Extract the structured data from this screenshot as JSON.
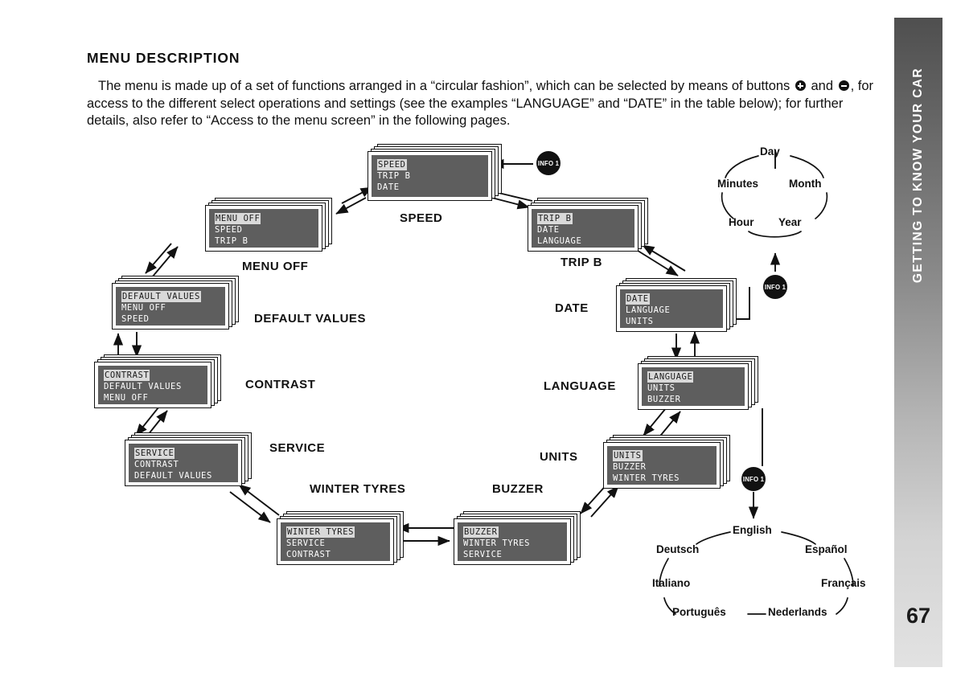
{
  "section": {
    "title": "MENU DESCRIPTION",
    "paragraph_part1": "The menu is made up of a set of functions arranged in a “circular fashion”, which can be selected by means of buttons",
    "paragraph_and": "and",
    "paragraph_part2": ", for access to the different select operations and settings (see the examples “LANGUAGE” and “DATE” in the table below); for further details, also refer to “Access to the menu screen” in the following pages."
  },
  "side_tab": {
    "chapter_label": "GETTING TO KNOW YOUR CAR",
    "page_number": "67",
    "gradient_top": "#4f4f4f",
    "gradient_bottom": "#e2e2e2"
  },
  "colors": {
    "lcd_background": "#5e5e5e",
    "lcd_text": "#ffffff",
    "lcd_highlight": "#d9d9d9",
    "ink": "#111111"
  },
  "info_badges": [
    {
      "id": "info-speed",
      "label": "INFO 1"
    },
    {
      "id": "info-date",
      "label": "INFO 1"
    },
    {
      "id": "info-language",
      "label": "INFO 1"
    }
  ],
  "panels": [
    {
      "id": "speed",
      "caption": "SPEED",
      "lines": [
        "SPEED",
        "TRIP B",
        "DATE"
      ],
      "selected": 0
    },
    {
      "id": "trip-b",
      "caption": "TRIP B",
      "lines": [
        "TRIP B",
        "DATE",
        "LANGUAGE"
      ],
      "selected": 0
    },
    {
      "id": "date",
      "caption": "DATE",
      "lines": [
        "DATE",
        "LANGUAGE",
        "UNITS"
      ],
      "selected": 0
    },
    {
      "id": "language",
      "caption": "LANGUAGE",
      "lines": [
        "LANGUAGE",
        "UNITS",
        "BUZZER"
      ],
      "selected": 0
    },
    {
      "id": "units",
      "caption": "UNITS",
      "lines": [
        "UNITS",
        "BUZZER",
        "WINTER TYRES"
      ],
      "selected": 0
    },
    {
      "id": "buzzer",
      "caption": "BUZZER",
      "lines": [
        "BUZZER",
        "WINTER TYRES",
        "SERVICE"
      ],
      "selected": 0
    },
    {
      "id": "winter-tyres",
      "caption": "WINTER TYRES",
      "lines": [
        "WINTER TYRES",
        "SERVICE",
        "CONTRAST"
      ],
      "selected": 0
    },
    {
      "id": "service",
      "caption": "SERVICE",
      "lines": [
        "SERVICE",
        "CONTRAST",
        "DEFAULT VALUES"
      ],
      "selected": 0
    },
    {
      "id": "contrast",
      "caption": "CONTRAST",
      "lines": [
        "CONTRAST",
        "DEFAULT VALUES",
        "MENU OFF"
      ],
      "selected": 0
    },
    {
      "id": "default-values",
      "caption": "DEFAULT VALUES",
      "lines": [
        "DEFAULT VALUES",
        "MENU OFF",
        "SPEED"
      ],
      "selected": 0
    },
    {
      "id": "menu-off",
      "caption": "MENU OFF",
      "lines": [
        "MENU OFF",
        "SPEED",
        "TRIP B"
      ],
      "selected": 0
    }
  ],
  "date_cycle": {
    "items": [
      "Day",
      "Month",
      "Year",
      "Hour",
      "Minutes"
    ]
  },
  "language_cycle": {
    "items": [
      "English",
      "Español",
      "Français",
      "Nederlands",
      "Português",
      "Italiano",
      "Deutsch"
    ]
  }
}
